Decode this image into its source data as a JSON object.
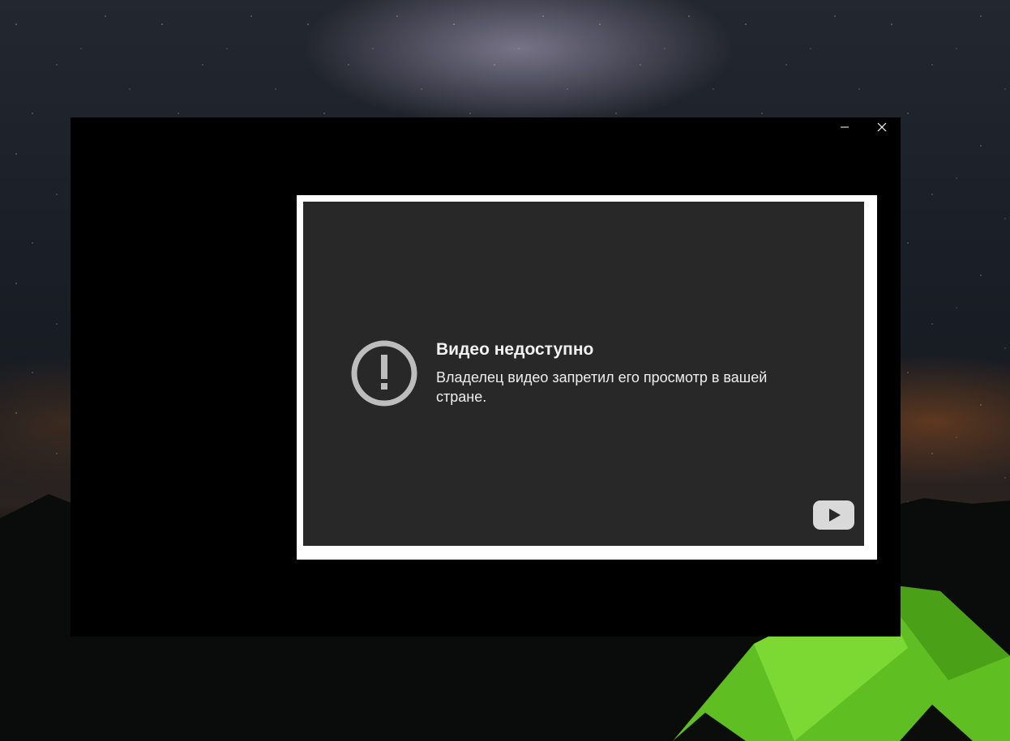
{
  "window": {
    "minimize_label": "minimize",
    "close_label": "close"
  },
  "player": {
    "error_title": "Видео недоступно",
    "error_message": "Владелец видео запретил его просмотр в вашей стране.",
    "icons": {
      "alert": "alert-circle-icon",
      "logo": "youtube-logo-icon"
    }
  },
  "colors": {
    "player_bg": "#282828",
    "frame_border": "#ffffff",
    "window_bg": "#000000",
    "icon_gray": "#bdbdbd",
    "tent_green": "#6ccc2a"
  }
}
